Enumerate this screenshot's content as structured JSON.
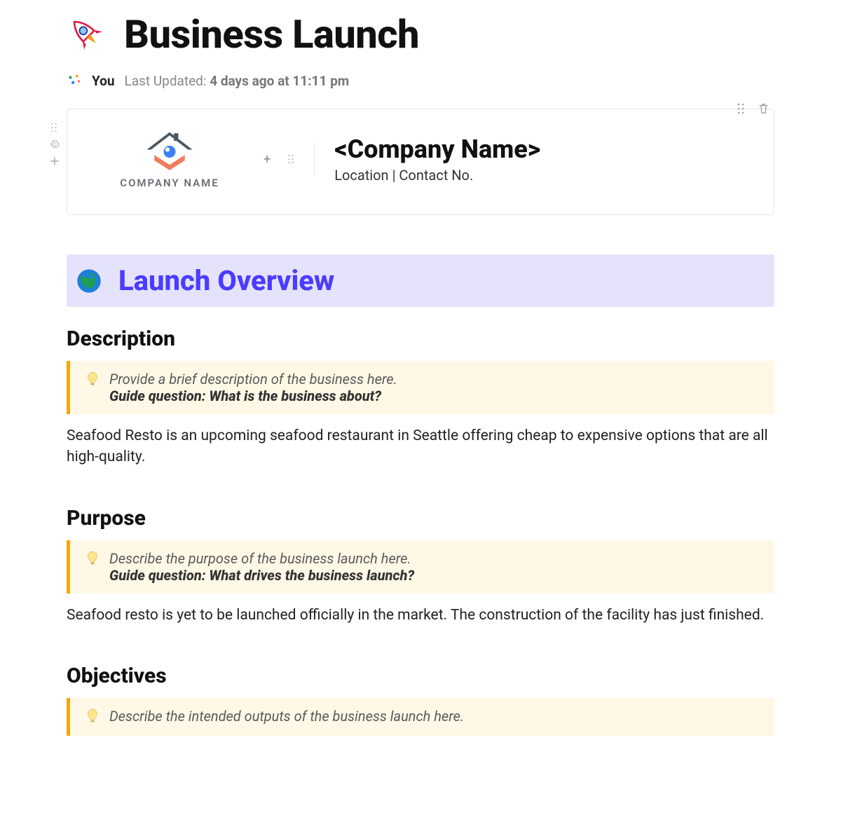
{
  "page": {
    "icon": "rocket-icon",
    "title": "Business Launch"
  },
  "meta": {
    "author": "You",
    "last_updated_prefix": "Last Updated: ",
    "last_updated_value": "4 days ago at 11:11 pm"
  },
  "company_card": {
    "logo_label": "COMPANY NAME",
    "name": "<Company Name>",
    "subtitle": "Location | Contact No."
  },
  "overview": {
    "banner_title": "Launch Overview",
    "sections": {
      "description": {
        "heading": "Description",
        "callout_hint": "Provide a brief description of the business here.",
        "callout_guide": "Guide question: What is the business about?",
        "body": "Seafood Resto is an upcoming seafood restaurant in Seattle offering cheap to expensive options that are all high-quality."
      },
      "purpose": {
        "heading": "Purpose",
        "callout_hint": "Describe the purpose of the business launch here.",
        "callout_guide": "Guide question: What drives the business launch?",
        "body": "Seafood resto is yet to be launched officially in the market. The construction of the facility has just finished."
      },
      "objectives": {
        "heading": "Objectives",
        "callout_hint": "Describe the intended outputs of the business launch here."
      }
    }
  }
}
